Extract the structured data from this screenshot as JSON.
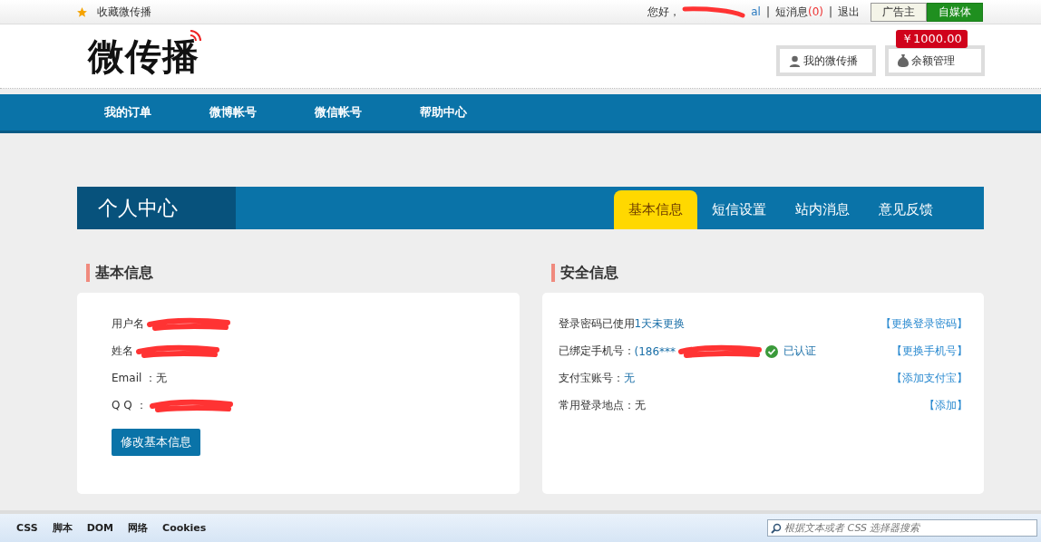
{
  "top_bar": {
    "favorite": "收藏微传播",
    "greeting": "您好，",
    "greeting_tail": "al",
    "separators": [
      "|",
      "|"
    ],
    "messages_label": "短消息",
    "messages_count": "(0)",
    "logout": "退出",
    "role_tabs": [
      {
        "label": "广告主",
        "selected": false
      },
      {
        "label": "自媒体",
        "selected": true
      }
    ]
  },
  "header": {
    "logo": "微传播",
    "balance_badge": "￥1000.00",
    "buttons": [
      {
        "label": "我的微传播",
        "kind": "user"
      },
      {
        "label": "余额管理",
        "kind": "money"
      }
    ]
  },
  "nav": [
    "我的订单",
    "微博帐号",
    "微信帐号",
    "帮助中心"
  ],
  "profile_bar": {
    "title": "个人中心",
    "tabs": [
      {
        "label": "基本信息",
        "selected": true
      },
      {
        "label": "短信设置",
        "selected": false
      },
      {
        "label": "站内消息",
        "selected": false
      },
      {
        "label": "意见反馈",
        "selected": false
      }
    ]
  },
  "basic_info": {
    "heading": "基本信息",
    "rows": [
      {
        "label": "用户名",
        "redacted": true
      },
      {
        "label": "姓名",
        "redacted": true
      },
      {
        "label": "Email ：无",
        "redacted": false
      },
      {
        "label": "Q Q ：",
        "redacted": true
      }
    ],
    "button": "修改基本信息"
  },
  "security_info": {
    "heading": "安全信息",
    "rows": [
      {
        "label": "登录密码已使用 ",
        "value": "1天未更换",
        "action": "【更换登录密码】"
      },
      {
        "label": "已绑定手机号：",
        "value": "(186***",
        "verified": "已认证",
        "action": "【更换手机号】"
      },
      {
        "label": "支付宝账号：",
        "value": "无",
        "action": "【添加支付宝】"
      },
      {
        "label": "常用登录地点：无",
        "action": "【添加】"
      }
    ]
  },
  "devtools": {
    "tabs": [
      "CSS",
      "脚本",
      "DOM",
      "网络",
      "Cookies"
    ],
    "search": {
      "placeholder": "根据文本或者 CSS 选择器搜索"
    }
  }
}
